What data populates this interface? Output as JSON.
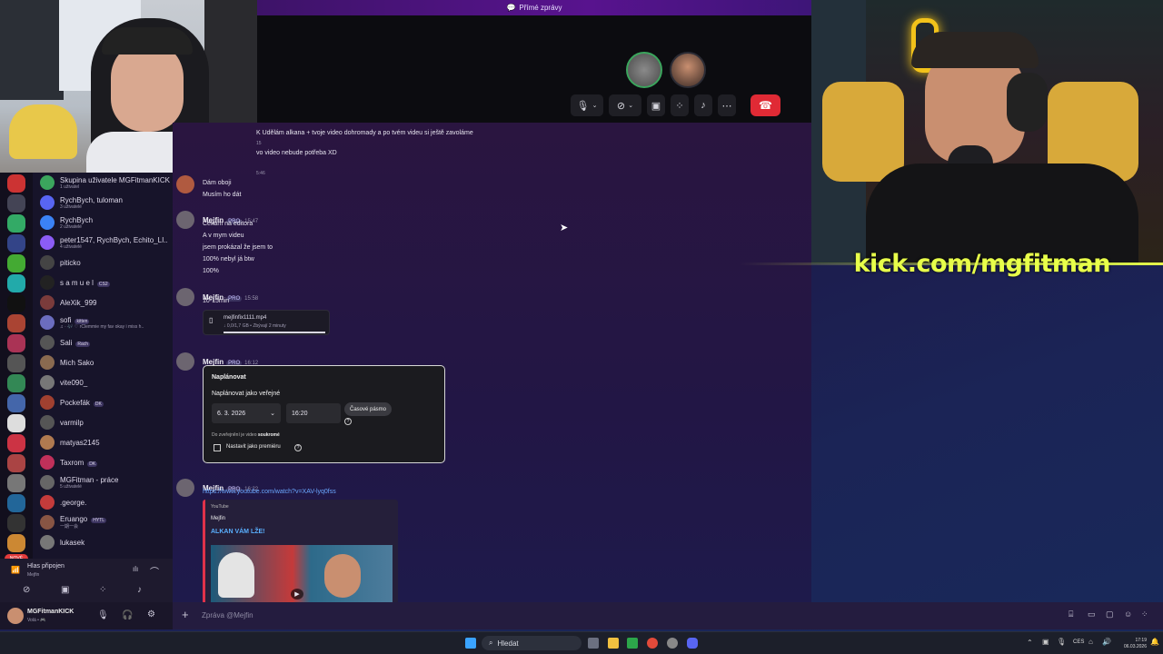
{
  "window": {
    "title": "Přímé zprávy"
  },
  "call": {
    "controls": [
      "mic",
      "camera",
      "screenshare",
      "activities",
      "soundboard",
      "more"
    ],
    "hangup_icon": "phone-hangup-icon"
  },
  "messages": {
    "top_line1": "K Udělám alkana + tvoje video dohromady a po tvém videu si ještě zavoláme",
    "top_time": "15",
    "top_line2": "vo video nebude potřeba XD",
    "small_time": "5:46",
    "m1": {
      "line1": "Dám oboji",
      "line2": "Musím ho dát"
    },
    "m2": {
      "user": "Mejfin",
      "badge": "PRO",
      "time": "15:47",
      "lines": [
        "Čekám na editora",
        "A v mym videu",
        "jsem prokázal že jsem to",
        "100% nebyl já btw",
        "100%"
      ]
    },
    "m3": {
      "user": "Mejfin",
      "badge": "PRO",
      "time": "15:58",
      "text": "10-15min",
      "file_name": "mejfinfix1111.mp4",
      "file_info": "↓ 0,0/1,7 GB • Zbývají 2 minuty"
    },
    "m4": {
      "user": "Mejfin",
      "badge": "PRO",
      "time": "16:12",
      "card_title": "Naplánovat",
      "card_subtitle": "Naplánovat jako veřejné",
      "date": "6. 3. 2026",
      "hour": "16:20",
      "tz_button": "Časové pásmo",
      "note_prefix": "Do zveřejnění je video ",
      "note_bold": "soukromé",
      "premiere": "Nastavit jako premiéru"
    },
    "m5": {
      "user": "Mejfin",
      "badge": "PRO",
      "time": "16:22",
      "link": "https://www.youtube.com/watch?v=XAV-lyq0fss",
      "embed_site": "YouTube",
      "embed_author": "Mejfin",
      "embed_title": "ALKAN VÁM LŽE!"
    }
  },
  "dm_list": [
    {
      "name": "Skupina uživatele MGFitmanKICK",
      "sub": "1 uživatel",
      "color": "#3ba55d"
    },
    {
      "name": "RychBych, tuloman",
      "sub": "3 uživatelé",
      "color": "#5865f2"
    },
    {
      "name": "RychBych",
      "sub": "2 uživatelé",
      "color": "#3b82f6"
    },
    {
      "name": "peter1547, RychBych, Echito_LI..",
      "sub": "4 uživatelé",
      "color": "#8b5cf6"
    },
    {
      "name": "piticko",
      "sub": "",
      "color": "#444"
    },
    {
      "name": "s a m u e l",
      "sub": "",
      "color": "#222",
      "tag": "CS2"
    },
    {
      "name": "AleXik_999",
      "sub": "",
      "color": "#7a3b3b"
    },
    {
      "name": "sofi",
      "sub": "♫ · 🎶 ♡ rClemmie my fav okay i miss h..",
      "color": "#6b6dbf",
      "tag": "kitten"
    },
    {
      "name": "Sali",
      "sub": "",
      "color": "#555",
      "tag": "Rach"
    },
    {
      "name": "Mich Sako",
      "sub": "",
      "color": "#8a6a50"
    },
    {
      "name": "vite090_",
      "sub": "",
      "color": "#777"
    },
    {
      "name": "Pockefák",
      "sub": "",
      "color": "#a04030",
      "tag": "DK"
    },
    {
      "name": "varmilp",
      "sub": "",
      "color": "#555"
    },
    {
      "name": "matyas2145",
      "sub": "",
      "color": "#b07a50"
    },
    {
      "name": "Taxrom",
      "sub": "",
      "color": "#c0305a",
      "tag": "DK"
    },
    {
      "name": "MGFitman - práce",
      "sub": "5 uživatelé",
      "color": "#666"
    },
    {
      "name": ".george.",
      "sub": "",
      "color": "#c43b3b"
    },
    {
      "name": "Eruango",
      "sub": "一期一会",
      "color": "#885544",
      "tag": "HYTL"
    },
    {
      "name": "lukasek",
      "sub": "",
      "color": "#777"
    }
  ],
  "server_badge": "NOVÉ",
  "voice": {
    "status": "Hlas připojen",
    "channel": "Mejfin"
  },
  "user": {
    "name": "MGFitmanKICK",
    "status": "Volá • 🎮"
  },
  "composer": {
    "placeholder": "Zpráva @Mejfin"
  },
  "overlay": {
    "kick_text": "kick.com/mgfitman"
  },
  "taskbar": {
    "search": "Hledat",
    "lang": "CES",
    "time": "17:19",
    "date": "06.03.2026"
  }
}
